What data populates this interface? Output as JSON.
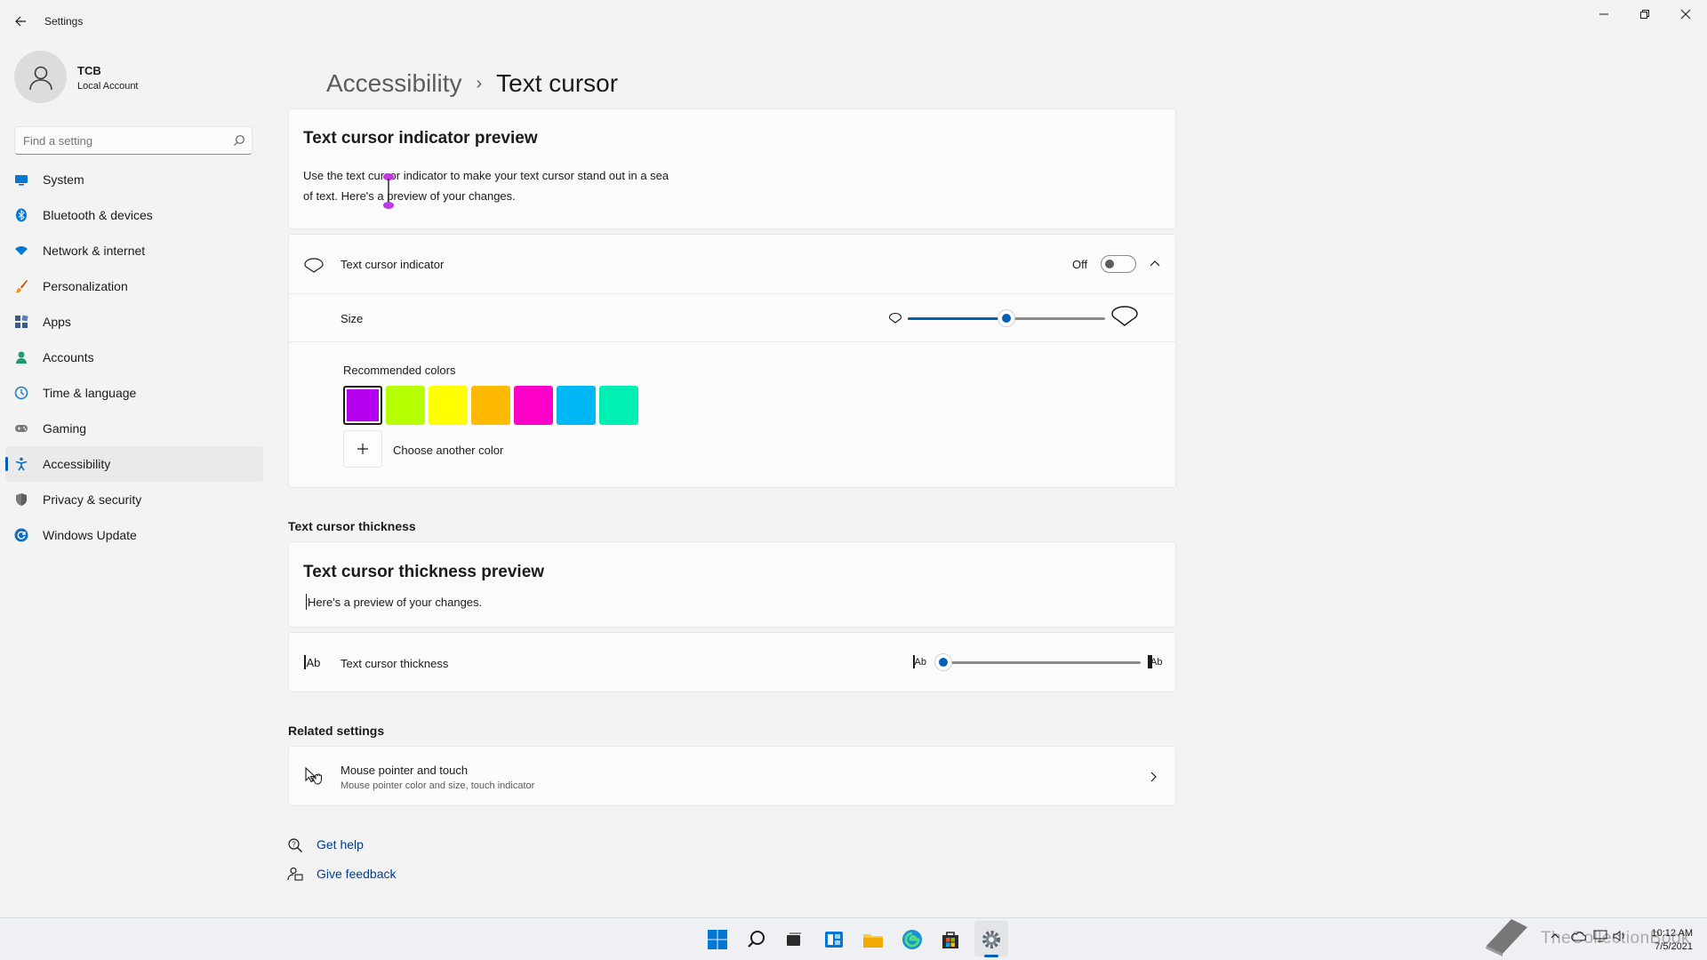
{
  "window": {
    "title": "Settings"
  },
  "account": {
    "name": "TCB",
    "type": "Local Account"
  },
  "search": {
    "placeholder": "Find a setting"
  },
  "sidebar": {
    "items": [
      {
        "label": "System"
      },
      {
        "label": "Bluetooth & devices"
      },
      {
        "label": "Network & internet"
      },
      {
        "label": "Personalization"
      },
      {
        "label": "Apps"
      },
      {
        "label": "Accounts"
      },
      {
        "label": "Time & language"
      },
      {
        "label": "Gaming"
      },
      {
        "label": "Accessibility"
      },
      {
        "label": "Privacy & security"
      },
      {
        "label": "Windows Update"
      }
    ],
    "active": "Accessibility"
  },
  "breadcrumb": {
    "parent": "Accessibility",
    "separator": "›",
    "current": "Text cursor"
  },
  "indicator_preview": {
    "title": "Text cursor indicator preview",
    "line1": "Use the text cursor indicator to make your text cursor stand out in a sea",
    "line2": "of text. Here's a preview of your changes."
  },
  "indicator": {
    "label": "Text cursor indicator",
    "state": "Off",
    "size_label": "Size",
    "size_level": 0.5,
    "colors_label": "Recommended colors",
    "colors": [
      "#b500f0",
      "#b6ff00",
      "#ffff00",
      "#ffb900",
      "#ff00c8",
      "#00b7f5",
      "#00f0b4"
    ],
    "selected_color": "#b500f0",
    "choose_label": "Choose another color"
  },
  "thickness_section": {
    "title": "Text cursor thickness"
  },
  "thickness_preview": {
    "title": "Text cursor thickness preview",
    "text": "Here's  a preview of your changes."
  },
  "thickness": {
    "label": "Text cursor thickness",
    "icon_text": "Ab",
    "level": 0
  },
  "related": {
    "title": "Related settings",
    "item": {
      "label": "Mouse pointer and touch",
      "description": "Mouse pointer color and size, touch indicator"
    }
  },
  "help": {
    "get_help": "Get help",
    "feedback": "Give feedback"
  },
  "watermark": "TheCollectionBook",
  "clock": {
    "time": "10:12 AM",
    "date": "7/5/2021"
  },
  "accent": "#005fb8"
}
